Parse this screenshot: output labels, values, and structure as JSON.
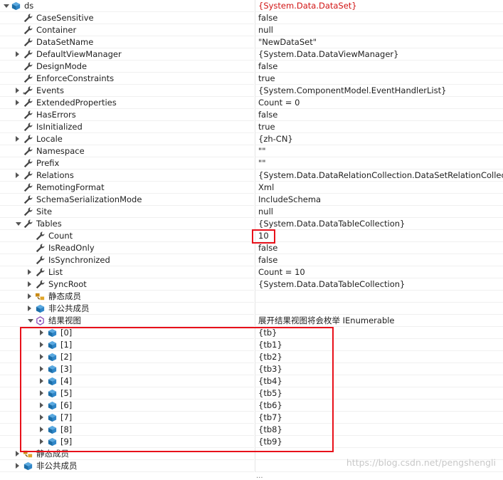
{
  "colors": {
    "accent_red": "#e8101a",
    "value_red": "#d11414",
    "cube_blue": "#1c6ea8",
    "wrench": "#444444",
    "lock_orange": "#c98a14"
  },
  "rows": [
    {
      "name": "ds",
      "value": "{System.Data.DataSet}",
      "icon": "cube-icon",
      "level": 0,
      "expander": "open",
      "red": true
    },
    {
      "name": "CaseSensitive",
      "value": "false",
      "icon": "wrench-icon",
      "level": 1,
      "expander": ""
    },
    {
      "name": "Container",
      "value": "null",
      "icon": "wrench-icon",
      "level": 1,
      "expander": ""
    },
    {
      "name": "DataSetName",
      "value": "\"NewDataSet\"",
      "icon": "wrench-icon",
      "level": 1,
      "expander": ""
    },
    {
      "name": "DefaultViewManager",
      "value": "{System.Data.DataViewManager}",
      "icon": "wrench-icon",
      "level": 1,
      "expander": "closed"
    },
    {
      "name": "DesignMode",
      "value": "false",
      "icon": "wrench-icon",
      "level": 1,
      "expander": ""
    },
    {
      "name": "EnforceConstraints",
      "value": "true",
      "icon": "wrench-icon",
      "level": 1,
      "expander": ""
    },
    {
      "name": "Events",
      "value": "{System.ComponentModel.EventHandlerList}",
      "icon": "wrench-star-icon",
      "level": 1,
      "expander": "closed"
    },
    {
      "name": "ExtendedProperties",
      "value": "Count = 0",
      "icon": "wrench-icon",
      "level": 1,
      "expander": "closed"
    },
    {
      "name": "HasErrors",
      "value": "false",
      "icon": "wrench-icon",
      "level": 1,
      "expander": ""
    },
    {
      "name": "IsInitialized",
      "value": "true",
      "icon": "wrench-icon",
      "level": 1,
      "expander": ""
    },
    {
      "name": "Locale",
      "value": "{zh-CN}",
      "icon": "wrench-icon",
      "level": 1,
      "expander": "closed"
    },
    {
      "name": "Namespace",
      "value": "\"\"",
      "icon": "wrench-icon",
      "level": 1,
      "expander": ""
    },
    {
      "name": "Prefix",
      "value": "\"\"",
      "icon": "wrench-icon",
      "level": 1,
      "expander": ""
    },
    {
      "name": "Relations",
      "value": "{System.Data.DataRelationCollection.DataSetRelationCollection}",
      "icon": "wrench-icon",
      "level": 1,
      "expander": "closed"
    },
    {
      "name": "RemotingFormat",
      "value": "Xml",
      "icon": "wrench-icon",
      "level": 1,
      "expander": ""
    },
    {
      "name": "SchemaSerializationMode",
      "value": "IncludeSchema",
      "icon": "wrench-icon",
      "level": 1,
      "expander": ""
    },
    {
      "name": "Site",
      "value": "null",
      "icon": "wrench-icon",
      "level": 1,
      "expander": ""
    },
    {
      "name": "Tables",
      "value": "{System.Data.DataTableCollection}",
      "icon": "wrench-icon",
      "level": 1,
      "expander": "open"
    },
    {
      "name": "Count",
      "value": "10",
      "icon": "wrench-icon",
      "level": 2,
      "expander": ""
    },
    {
      "name": "IsReadOnly",
      "value": "false",
      "icon": "wrench-icon",
      "level": 2,
      "expander": ""
    },
    {
      "name": "IsSynchronized",
      "value": "false",
      "icon": "wrench-icon",
      "level": 2,
      "expander": ""
    },
    {
      "name": "List",
      "value": "Count = 10",
      "icon": "wrench-icon",
      "level": 2,
      "expander": "closed"
    },
    {
      "name": "SyncRoot",
      "value": "{System.Data.DataTableCollection}",
      "icon": "wrench-icon",
      "level": 2,
      "expander": "closed"
    },
    {
      "name": "静态成员",
      "value": "",
      "icon": "static-members-icon",
      "level": 2,
      "expander": "closed"
    },
    {
      "name": "非公共成员",
      "value": "",
      "icon": "cube-icon",
      "level": 2,
      "expander": "closed"
    },
    {
      "name": "结果视图",
      "value": "展开结果视图将会枚举 IEnumerable",
      "icon": "results-view-icon",
      "level": 2,
      "expander": "open"
    },
    {
      "name": "[0]",
      "value": "{tb}",
      "icon": "cube-icon",
      "level": 3,
      "expander": "closed"
    },
    {
      "name": "[1]",
      "value": "{tb1}",
      "icon": "cube-icon",
      "level": 3,
      "expander": "closed"
    },
    {
      "name": "[2]",
      "value": "{tb2}",
      "icon": "cube-icon",
      "level": 3,
      "expander": "closed"
    },
    {
      "name": "[3]",
      "value": "{tb3}",
      "icon": "cube-icon",
      "level": 3,
      "expander": "closed"
    },
    {
      "name": "[4]",
      "value": "{tb4}",
      "icon": "cube-icon",
      "level": 3,
      "expander": "closed"
    },
    {
      "name": "[5]",
      "value": "{tb5}",
      "icon": "cube-icon",
      "level": 3,
      "expander": "closed"
    },
    {
      "name": "[6]",
      "value": "{tb6}",
      "icon": "cube-icon",
      "level": 3,
      "expander": "closed"
    },
    {
      "name": "[7]",
      "value": "{tb7}",
      "icon": "cube-icon",
      "level": 3,
      "expander": "closed"
    },
    {
      "name": "[8]",
      "value": "{tb8}",
      "icon": "cube-icon",
      "level": 3,
      "expander": "closed"
    },
    {
      "name": "[9]",
      "value": "{tb9}",
      "icon": "cube-icon",
      "level": 3,
      "expander": "closed"
    },
    {
      "name": "静态成员",
      "value": "",
      "icon": "static-members-icon",
      "level": 1,
      "expander": "closed"
    },
    {
      "name": "非公共成员",
      "value": "",
      "icon": "cube-icon",
      "level": 1,
      "expander": "closed"
    }
  ],
  "partial_row_value": "...",
  "watermark": "https://blog.csdn.net/pengshengli"
}
